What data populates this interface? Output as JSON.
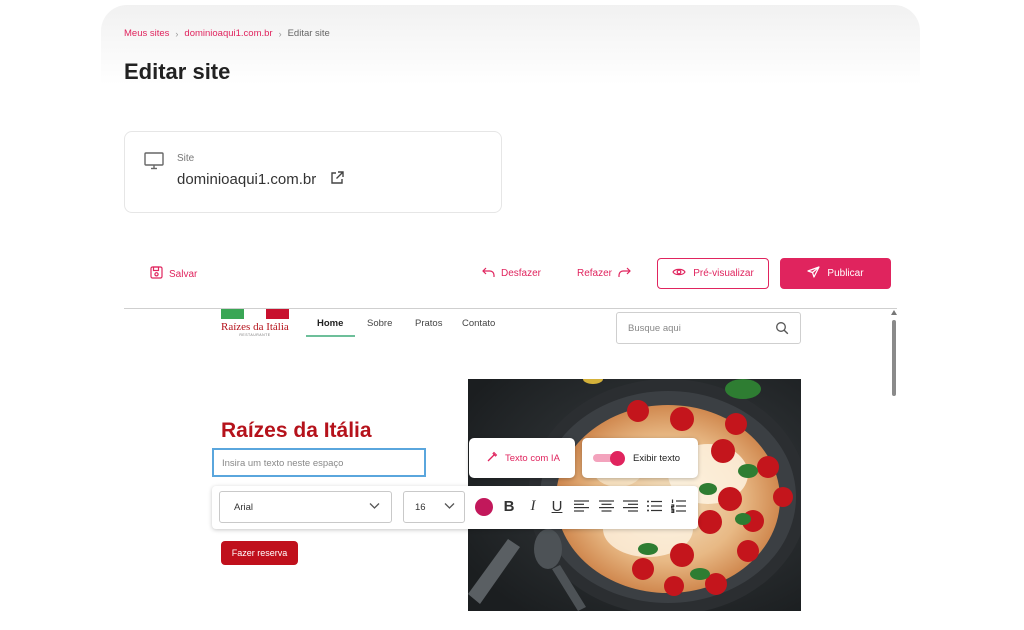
{
  "breadcrumb": {
    "items": [
      "Meus sites",
      "dominioaqui1.com.br"
    ],
    "current": "Editar site"
  },
  "page_title": "Editar site",
  "site_card": {
    "label": "Site",
    "domain": "dominioaqui1.com.br"
  },
  "toolbar": {
    "save_label": "Salvar",
    "undo_label": "Desfazer",
    "redo_label": "Refazer",
    "preview_label": "Pré-visualizar",
    "publish_label": "Publicar"
  },
  "preview": {
    "logo": {
      "name": "Raízes da Itália",
      "sub": "RESTAURANTE"
    },
    "nav": [
      "Home",
      "Sobre",
      "Pratos",
      "Contato"
    ],
    "active_nav": "Home",
    "search_placeholder": "Busque aqui",
    "hero_title": "Raízes da Itália",
    "text_placeholder": "Insira um texto neste espaço",
    "ai_button_label": "Texto com IA",
    "toggle_label": "Exibir texto",
    "toggle_on": true,
    "font_family": "Arial",
    "font_size": "16",
    "text_color": "#c2185b",
    "reserve_button": "Fazer reserva"
  },
  "colors": {
    "accent": "#e0245e",
    "brand_red": "#b5121b",
    "input_focus": "#5aa6dd"
  }
}
